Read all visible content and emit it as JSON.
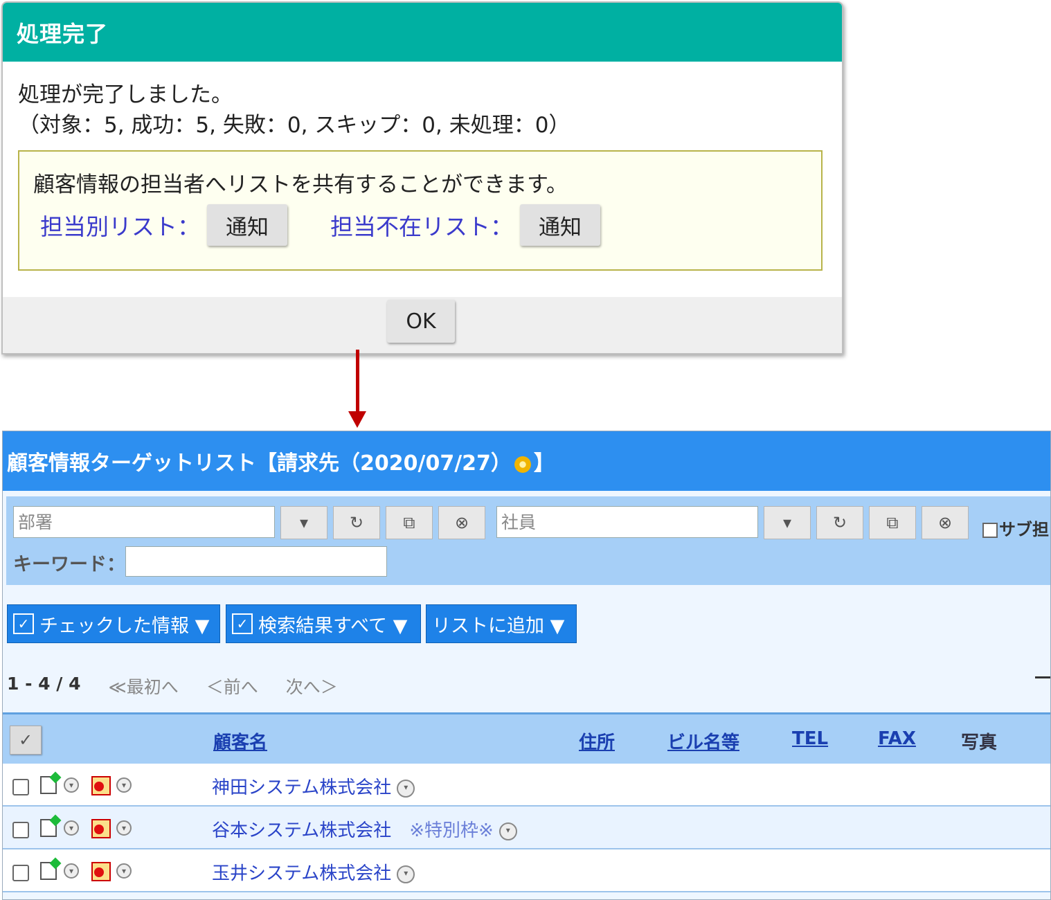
{
  "dialog": {
    "title": "処理完了",
    "message": "処理が完了しました。",
    "stats": "（対象：5, 成功：5, 失敗：0, スキップ：0, 未処理：0）",
    "share_text": "顧客情報の担当者へリストを共有することができます。",
    "by_person_label": "担当別リスト：",
    "absent_label": "担当不在リスト：",
    "notify_label": "通知",
    "ok_label": "OK"
  },
  "screen": {
    "title_prefix": "顧客情報ターゲットリスト【請求先（2020/07/27）",
    "title_suffix": "】",
    "filter": {
      "department_placeholder": "部署",
      "employee_placeholder": "社員",
      "sub_label": "サブ担",
      "keyword_label": "キーワード：",
      "btn_dropdown": "▾",
      "btn_reset": "↻",
      "btn_copy": "⧉",
      "btn_clear": "⊗"
    },
    "actions": {
      "checked": "チェックした情報 ▼",
      "all_results": "検索結果すべて ▼",
      "add_to_list": "リストに追加 ▼"
    },
    "pager": {
      "count": "1 - 4 / 4",
      "first": "≪最初へ",
      "prev": "＜前へ",
      "next": "次へ＞"
    },
    "columns": {
      "customer": "顧客名",
      "address": "住所",
      "building": "ビル名等",
      "tel": "TEL",
      "fax": "FAX",
      "photo": "写真"
    },
    "rows": [
      {
        "name": "神田システム株式会社",
        "note": ""
      },
      {
        "name": "谷本システム株式会社",
        "note": "※特別枠※"
      },
      {
        "name": "玉井システム株式会社",
        "note": ""
      }
    ]
  },
  "colors": {
    "dialog_header": "#00b0a2",
    "screen_header": "#2d8ff0",
    "arrow": "#c00000",
    "link": "#3a3acb"
  }
}
